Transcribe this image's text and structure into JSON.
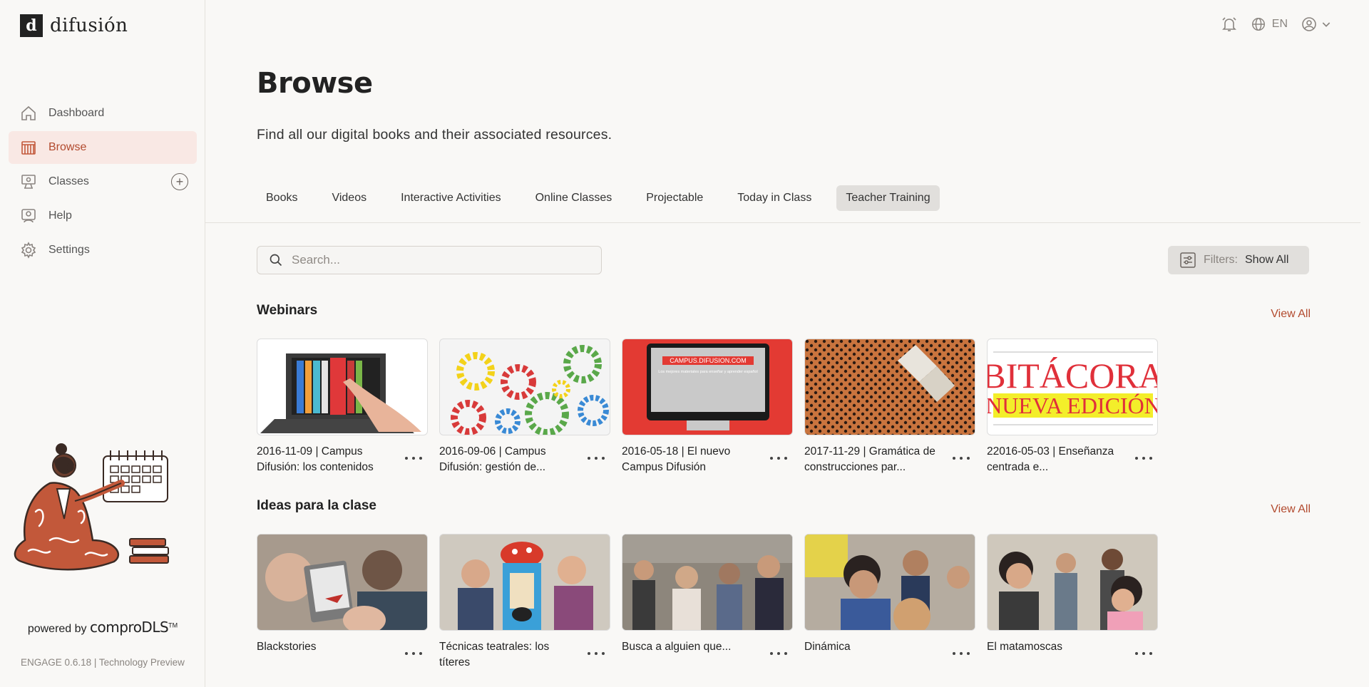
{
  "app": {
    "brand": "difusión",
    "brand_mark": "d"
  },
  "sidebar": {
    "items": [
      {
        "label": "Dashboard",
        "icon": "home-icon"
      },
      {
        "label": "Browse",
        "icon": "books-icon"
      },
      {
        "label": "Classes",
        "icon": "classroom-icon"
      },
      {
        "label": "Help",
        "icon": "help-icon"
      },
      {
        "label": "Settings",
        "icon": "gear-icon"
      }
    ],
    "powered_by": "powered by",
    "powered_brand": "comproDLS",
    "trademark": "TM",
    "version": "ENGAGE 0.6.18 | Technology Preview"
  },
  "topbar": {
    "language": "EN"
  },
  "page": {
    "title": "Browse",
    "subtitle": "Find all our digital books and their associated resources."
  },
  "tabs": [
    {
      "label": "Books"
    },
    {
      "label": "Videos"
    },
    {
      "label": "Interactive Activities"
    },
    {
      "label": "Online Classes"
    },
    {
      "label": "Projectable"
    },
    {
      "label": "Today in Class"
    },
    {
      "label": "Teacher Training"
    }
  ],
  "search": {
    "placeholder": "Search..."
  },
  "filters": {
    "label": "Filters:",
    "value": "Show All"
  },
  "sections": [
    {
      "title": "Webinars",
      "view_all": "View All",
      "cards": [
        {
          "title": "2016-11-09 | Campus Difusión: los contenidos"
        },
        {
          "title": "2016-09-06 | Campus Difusión: gestión de..."
        },
        {
          "title": "2016-05-18 | El nuevo Campus Difusión",
          "thumb_heading": "CAMPUS.DIFUSION.COM",
          "thumb_tagline": "Los mejores materiales para enseñar y aprender español"
        },
        {
          "title": "2017-11-29 | Gramática de construcciones par..."
        },
        {
          "title": "22016-05-03 | Enseñanza centrada e...",
          "thumb_line1": "BITÁCORA",
          "thumb_line2": "NUEVA EDICIÓN"
        }
      ]
    },
    {
      "title": "Ideas para la clase",
      "view_all": "View All",
      "cards": [
        {
          "title": "Blackstories"
        },
        {
          "title": "Técnicas teatrales: los títeres"
        },
        {
          "title": "Busca a alguien que..."
        },
        {
          "title": "Dinámica"
        },
        {
          "title": "El matamoscas"
        }
      ]
    }
  ],
  "colors": {
    "accent": "#b24a2e",
    "active_bg": "#f9e8e4",
    "background": "#f9f8f6"
  }
}
